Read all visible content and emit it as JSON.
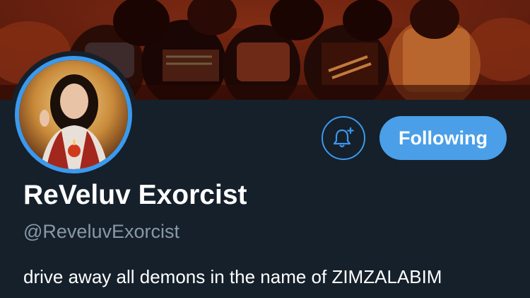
{
  "profile": {
    "display_name": "ReVeluv Exorcist",
    "handle": "@ReveluvExorcist",
    "bio": "drive away all demons in the name of ZIMZALABIM"
  },
  "actions": {
    "notify_icon": "bell-plus-icon",
    "following_label": "Following"
  },
  "colors": {
    "background": "#15202b",
    "accent": "#3b99ee",
    "button_fill": "#4a9fe8",
    "secondary_text": "#8899a6"
  }
}
